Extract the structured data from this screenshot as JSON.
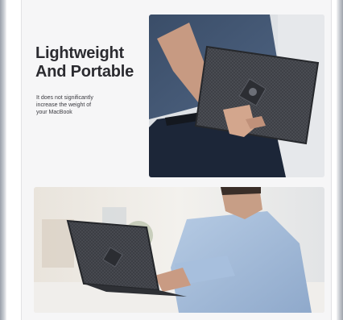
{
  "feature": {
    "headline": [
      "Lightweight",
      "And Portable"
    ],
    "subtext": [
      "It does not significantly",
      "increase the weight of",
      "your MacBook"
    ]
  },
  "images": {
    "top": "Person holding a MacBook in a dark textured protective case",
    "bottom": "Man in a light blue shirt typing on a MacBook with a dark case at a table"
  },
  "colors": {
    "text": "#2b2b30",
    "case": "#3e4046",
    "shirt": "#9fb9d8",
    "background": "#f6f6f7"
  }
}
